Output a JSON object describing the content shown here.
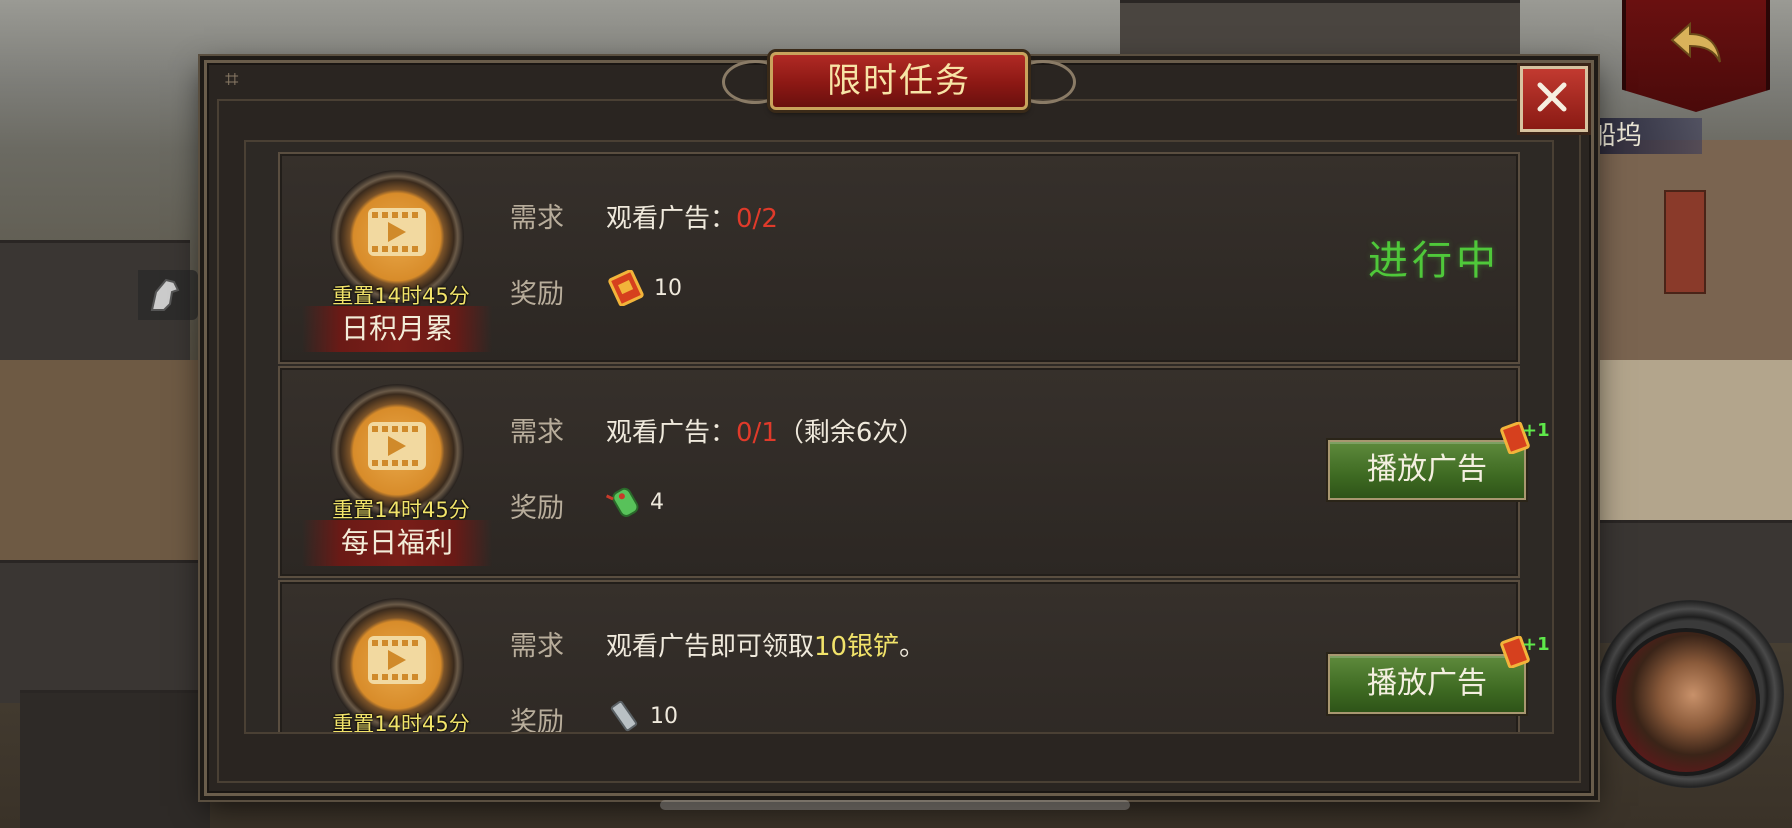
{
  "modal": {
    "title": "限时任务",
    "close_icon": "close-icon"
  },
  "side": {
    "right_label": "船坞"
  },
  "colors": {
    "progress_red": "#e03a2a",
    "highlight_yellow": "#f1e36a",
    "status_green": "#4fc83a",
    "button_green": "#3e6a22"
  },
  "tasks": [
    {
      "name": "日积月累",
      "reset": "重置14时45分",
      "requirement_label": "需求",
      "requirement_text": "观看广告：",
      "progress": "0/2",
      "extra": "",
      "reward_label": "奖励",
      "reward_icon": "red-token-icon",
      "reward_amount": "10",
      "status": "进行中"
    },
    {
      "name": "每日福利",
      "reset": "重置14时45分",
      "requirement_label": "需求",
      "requirement_text": "观看广告：",
      "progress": "0/1",
      "extra": "（剩余6次）",
      "reward_label": "奖励",
      "reward_icon": "green-jade-icon",
      "reward_amount": "4",
      "button": "播放广告",
      "button_badge": "+1"
    },
    {
      "name": "",
      "reset": "重置14时45分",
      "requirement_label": "需求",
      "requirement_prefix": "观看广告即可领取",
      "requirement_highlight": "10银铲",
      "requirement_suffix": "。",
      "reward_label": "奖励",
      "reward_icon": "silver-shovel-icon",
      "reward_amount": "10",
      "button": "播放广告",
      "button_badge": "+1"
    }
  ]
}
